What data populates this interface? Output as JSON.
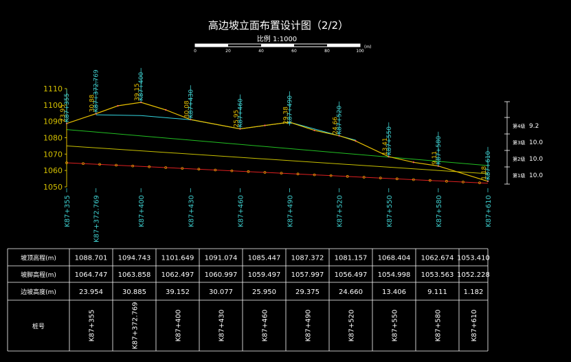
{
  "title": "高边坡立面布置设计图（2/2）",
  "scale": {
    "label": "比例 1:1000",
    "unit": "(m)",
    "ticks": [
      "0",
      "20",
      "40",
      "60",
      "80",
      "100"
    ]
  },
  "chart_data": {
    "type": "line",
    "ylim": [
      1050,
      1110
    ],
    "yticks": [
      "1050",
      "1060",
      "1070",
      "1080",
      "1090",
      "1100",
      "1110"
    ],
    "stations": [
      "K87+355",
      "K87+372.769",
      "K87+400",
      "K87+430",
      "K87+460",
      "K87+490",
      "K87+520",
      "K87+550",
      "K87+580",
      "K87+610"
    ],
    "station_chainage": [
      355,
      372.769,
      400,
      430,
      460,
      490,
      520,
      550,
      580,
      610
    ],
    "top_elevation": [
      1088.701,
      1094.743,
      1101.649,
      1091.074,
      1085.447,
      1087.372,
      1081.157,
      1068.404,
      1062.674,
      1053.41
    ],
    "toe_elevation": [
      1064.747,
      1063.858,
      1062.497,
      1060.997,
      1059.497,
      1057.997,
      1056.497,
      1054.998,
      1053.563,
      1052.228
    ],
    "height_labels": [
      "23.95",
      "30.88",
      "39.15",
      "30.08",
      "25.95",
      "29.38",
      "24.66",
      "13.41",
      "9.11",
      "1.18"
    ],
    "ground_profile": {
      "x": [
        355,
        372.769,
        386,
        400,
        415,
        430,
        460,
        475,
        490,
        505,
        520,
        530,
        550,
        565,
        580,
        610
      ],
      "y": [
        1088.7,
        1094.7,
        1099.5,
        1101.6,
        1097,
        1091.1,
        1085.4,
        1087.5,
        1089.5,
        1084.5,
        1081.2,
        1078,
        1068.4,
        1065,
        1062.7,
        1053.4
      ]
    },
    "berms": [
      {
        "name": "第4级",
        "value": "9.2",
        "x": [
          372.769,
          400,
          430,
          460,
          490,
          520,
          530
        ],
        "y": [
          1094,
          1093.5,
          1091,
          1085.4,
          1089.5,
          1081.2,
          1078.5
        ]
      },
      {
        "name": "第3级",
        "value": "10.0",
        "x": [
          355,
          610
        ],
        "y": [
          1085,
          1063
        ]
      },
      {
        "name": "第2级",
        "value": "10.0",
        "x": [
          355,
          610
        ],
        "y": [
          1075,
          1058
        ]
      },
      {
        "name": "第1级",
        "value": "10.0",
        "x": [
          355,
          610
        ],
        "y": [
          1064.7,
          1052.2
        ]
      }
    ]
  },
  "table": {
    "row_labels": [
      "坡顶高程(m)",
      "坡脚高程(m)",
      "边坡高度(m)",
      "桩号"
    ],
    "top_elevation": [
      "1088.701",
      "1094.743",
      "1101.649",
      "1091.074",
      "1085.447",
      "1087.372",
      "1081.157",
      "1068.404",
      "1062.674",
      "1053.410"
    ],
    "toe_elevation": [
      "1064.747",
      "1063.858",
      "1062.497",
      "1060.997",
      "1059.497",
      "1057.997",
      "1056.497",
      "1054.998",
      "1053.563",
      "1052.228"
    ],
    "slope_height": [
      "23.954",
      "30.885",
      "39.152",
      "30.077",
      "25.950",
      "29.375",
      "24.660",
      "13.406",
      "9.111",
      "1.182"
    ]
  },
  "colors": {
    "axis": "#d4c000",
    "station": "#3fd0d0",
    "ground": "#e8c000",
    "cyan_line": "#33d6e0",
    "green_line": "#22c022",
    "yellow_line": "#c8c000",
    "red_line": "#e02020",
    "table": "#ffffff"
  }
}
